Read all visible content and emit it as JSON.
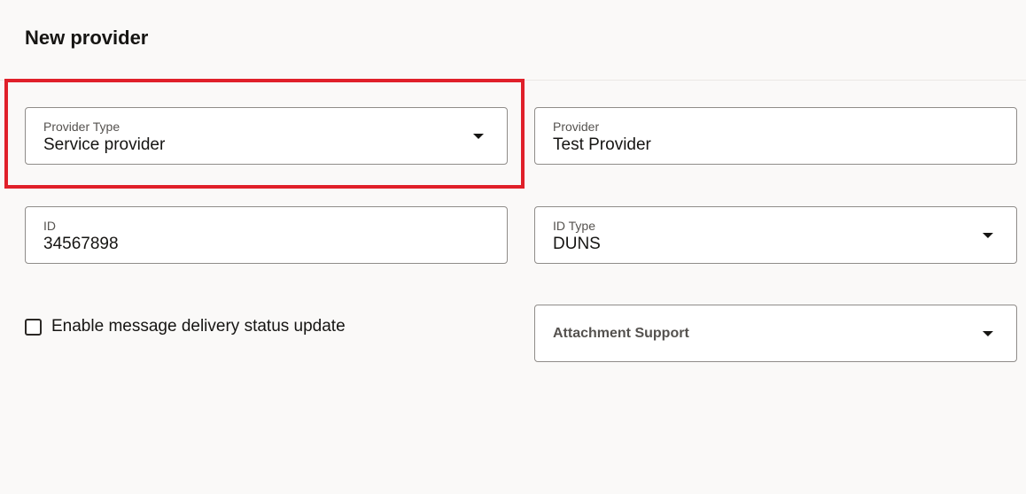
{
  "header": {
    "title": "New provider"
  },
  "form": {
    "provider_type": {
      "label": "Provider Type",
      "value": "Service provider"
    },
    "provider": {
      "label": "Provider",
      "value": "Test Provider"
    },
    "id": {
      "label": "ID",
      "value": "34567898"
    },
    "id_type": {
      "label": "ID Type",
      "value": "DUNS"
    },
    "enable_status": {
      "label": "Enable message delivery status update",
      "checked": false
    },
    "attachment_support": {
      "label": "Attachment Support"
    }
  },
  "colors": {
    "highlight": "#e0202a"
  }
}
